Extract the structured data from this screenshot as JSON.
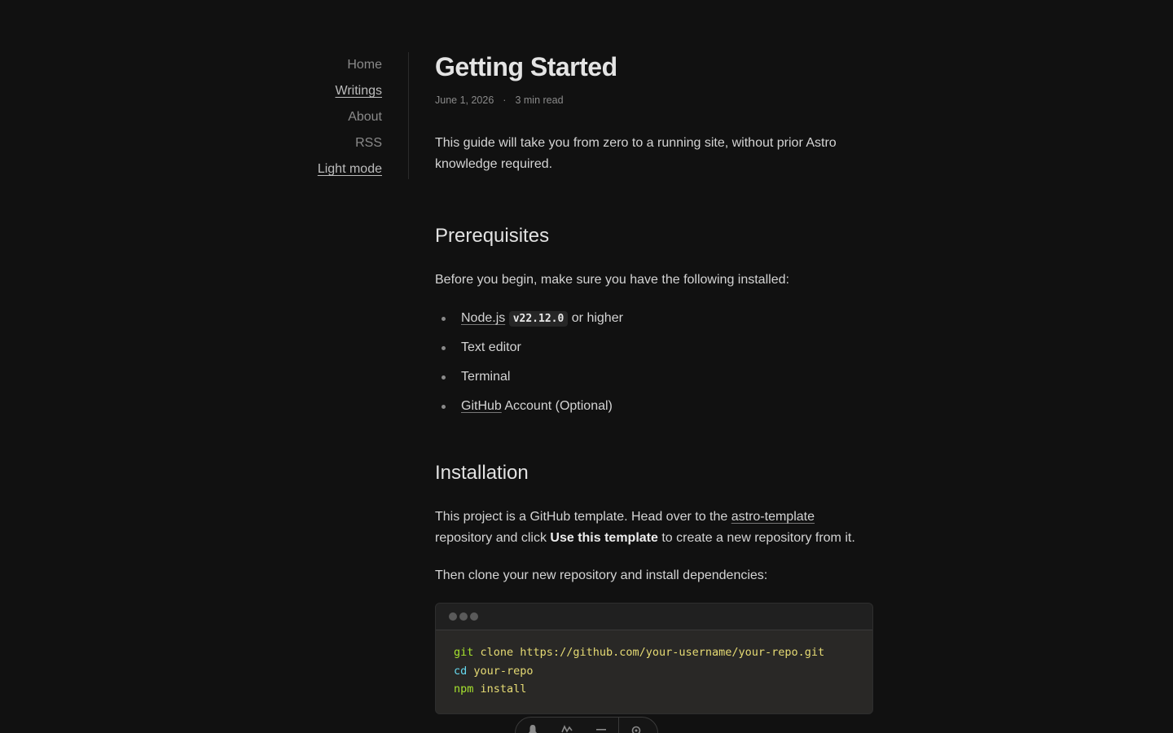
{
  "nav": {
    "items": [
      {
        "label": "Home"
      },
      {
        "label": "Writings"
      },
      {
        "label": "About"
      },
      {
        "label": "RSS"
      },
      {
        "label": "Light mode"
      }
    ]
  },
  "article": {
    "title": "Getting Started",
    "date": "June 1, 2026",
    "separator": "·",
    "read_time": "3 min read",
    "intro": "This guide will take you from zero to a running site, without prior Astro knowledge required.",
    "prereq_heading": "Prerequisites",
    "prereq_text": "Before you begin, make sure you have the following installed:",
    "list": {
      "node_link": "Node.js",
      "node_version": "v22.12.0",
      "node_suffix": "or higher",
      "editor": "Text editor",
      "terminal": "Terminal",
      "github_link": "GitHub",
      "github_suffix": "Account (Optional)"
    },
    "install_heading": "Installation",
    "install_text_1": "This project is a GitHub template. Head over to the",
    "install_link": "astro-template",
    "install_text_2": "repository and click",
    "install_bold": "Use this template",
    "install_text_3": "to create a new repository from it.",
    "clone_text": "Then clone your new repository and install dependencies:",
    "code": {
      "line1_cmd": "git",
      "line1_args": "clone https://github.com/your-username/your-repo.git",
      "line2_cmd": "cd",
      "line2_args": "your-repo",
      "line3_cmd": "npm",
      "line3_args": "install"
    }
  },
  "toolbar": {
    "icons": [
      "bell-icon",
      "wave-icon",
      "menu-icon",
      "gear-icon"
    ]
  }
}
